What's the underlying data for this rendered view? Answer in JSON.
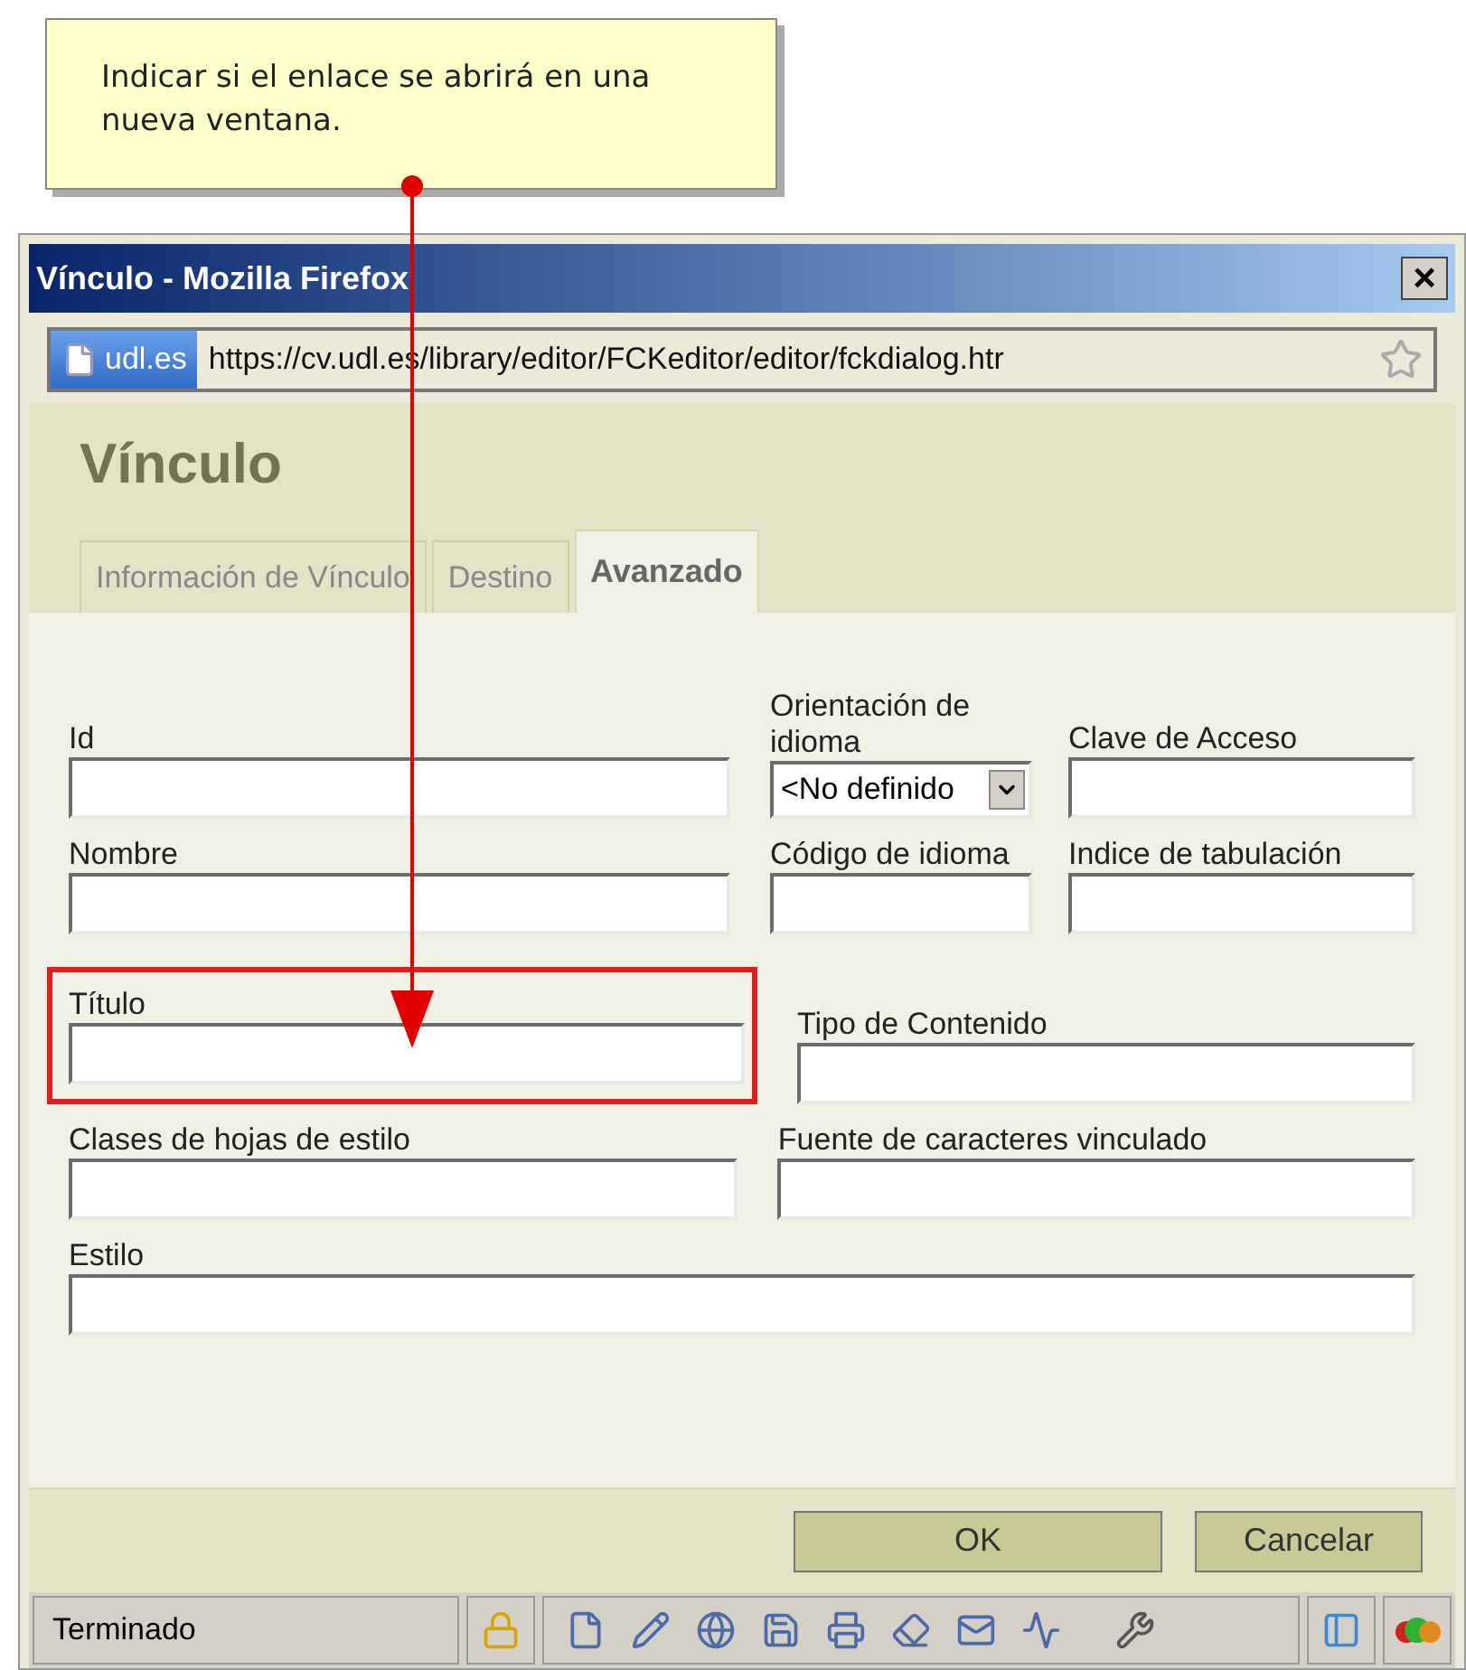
{
  "callout": {
    "text": "Indicar si el enlace se abrirá en una nueva ventana."
  },
  "window": {
    "title": "Vínculo - Mozilla Firefox",
    "close": "×"
  },
  "address_bar": {
    "domain": "udl.es",
    "url": "https://cv.udl.es/library/editor/FCKeditor/editor/fckdialog.htr"
  },
  "dialog": {
    "title": "Vínculo",
    "tabs": [
      {
        "label": "Información de Vínculo",
        "selected": false
      },
      {
        "label": "Destino",
        "selected": false
      },
      {
        "label": "Avanzado",
        "selected": true
      }
    ],
    "rows": [
      [
        {
          "label": "Id",
          "kind": "text",
          "highlighted": false
        },
        {
          "label": "Orientación de idioma",
          "kind": "select",
          "value": "<No definido",
          "highlighted": false
        },
        {
          "label": "Clave de Acceso",
          "kind": "text",
          "highlighted": false
        }
      ],
      [
        {
          "label": "Nombre",
          "kind": "text",
          "highlighted": false
        },
        {
          "label": "Código de idioma",
          "kind": "text",
          "highlighted": false
        },
        {
          "label": "Indice de tabulación",
          "kind": "text",
          "highlighted": false
        }
      ],
      [
        {
          "label": "Título",
          "kind": "text",
          "highlighted": true
        },
        {
          "label": "Tipo de Contenido",
          "kind": "text",
          "highlighted": false
        }
      ],
      [
        {
          "label": "Clases de hojas de estilo",
          "kind": "text",
          "highlighted": false
        },
        {
          "label": "Fuente de caracteres vinculado",
          "kind": "text",
          "highlighted": false
        }
      ],
      [
        {
          "label": "Estilo",
          "kind": "text",
          "highlighted": false
        }
      ]
    ],
    "buttons": [
      "OK",
      "Cancelar"
    ]
  },
  "status_bar": {
    "text": "Terminado"
  }
}
